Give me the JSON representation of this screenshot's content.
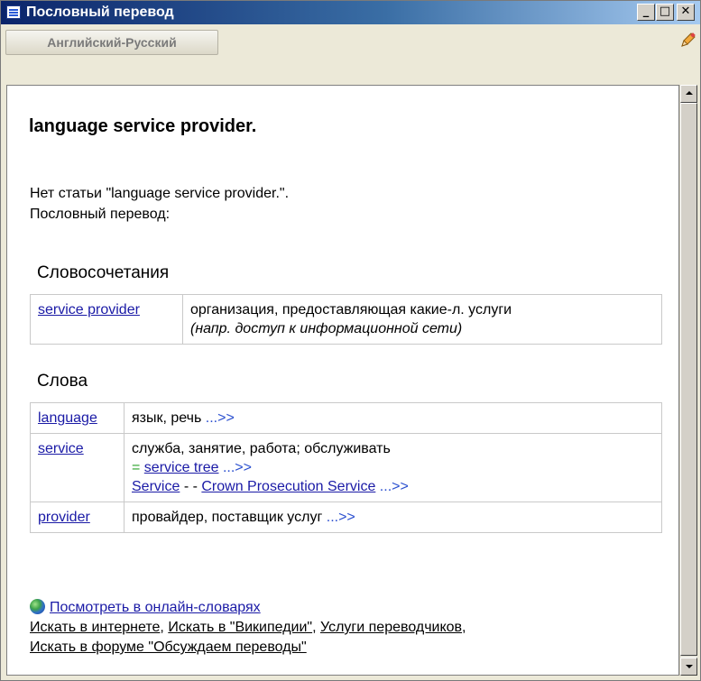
{
  "window": {
    "title": "Пословный перевод",
    "controls": {
      "minimize": "_",
      "maximize": "□",
      "close": "✕"
    }
  },
  "toolbar": {
    "language_pair": "Английский-Русский",
    "tool_icon": "pencil-icon"
  },
  "article": {
    "heading": "language service provider.",
    "no_entry": "Нет статьи \"language service provider.\".",
    "literal_label": "Пословный перевод:"
  },
  "phrases": {
    "title": "Словосочетания",
    "rows": [
      {
        "term": "service provider",
        "translation": "организация, предоставляющая какие-л. услуги",
        "note": "(напр. доступ к информационной сети)"
      }
    ]
  },
  "words": {
    "title": "Слова",
    "more": "...>>",
    "rows": [
      {
        "term": "language",
        "translation": "язык, речь"
      },
      {
        "term": "service",
        "translation": "служба, занятие, работа; обслуживать",
        "eq": "=",
        "ref": "service tree",
        "ref2_a": "Service",
        "ref2_sep": "- -",
        "ref2_b": "Crown Prosecution Service"
      },
      {
        "term": "provider",
        "translation": "провайдер, поставщик услуг"
      }
    ]
  },
  "footer": {
    "online": "Посмотреть в онлайн-словарях",
    "search_internet": "Искать в интернете",
    "sep1": ", ",
    "search_wiki": "Искать в \"Википедии\"",
    "sep2": ", ",
    "translators": "Услуги переводчиков",
    "sep3": ",",
    "forum": "Искать в форуме \"Обсуждаем переводы\""
  },
  "colors": {
    "link": "#1a1aa6",
    "more_link": "#2a4fcf",
    "eq": "#2aa32a",
    "titlebar_start": "#0a246a"
  }
}
